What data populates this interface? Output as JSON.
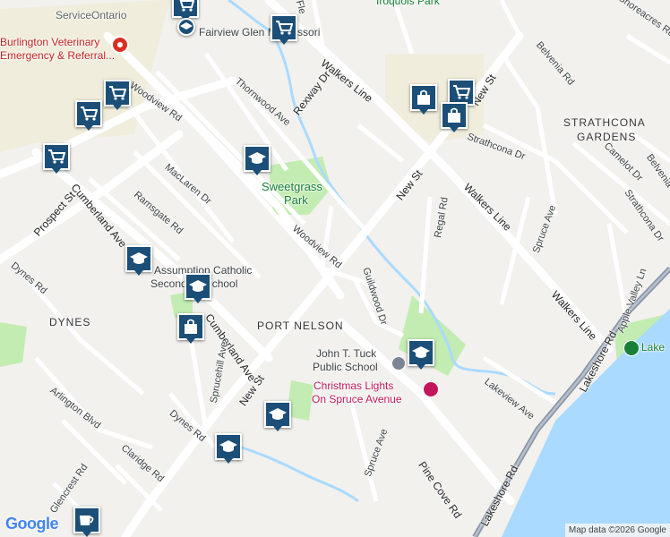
{
  "colors": {
    "water": "#aadaff",
    "park": "#c3ecb2",
    "road": "#ffffff",
    "arterial": "#ffffff",
    "highway": "#8a96a8",
    "commercial": "#f1eddc",
    "pin": "#1b4f77",
    "poi_red": "#d93025",
    "poi_pink": "#c2185b"
  },
  "areas": {
    "port_nelson": "PORT NELSON",
    "dynes": "DYNES",
    "strathcona_1": "STRATHCONA",
    "strathcona_2": "GARDENS"
  },
  "roads": {
    "walkers_line_1": "Walkers Line",
    "walkers_line_2": "Walkers Line",
    "walkers_line_3": "Walkers Line",
    "rexway": "Rexway Dr",
    "new_st_1": "New St",
    "new_st_2": "New St",
    "new_st_3": "New St",
    "cumberland_1": "Cumberland Ave",
    "cumberland_2": "Cumberland Ave",
    "prospect": "Prospect St",
    "woodview_1": "Woodview Rd",
    "woodview_2": "Woodview Rd",
    "thornwood": "Thornwood Ave",
    "maclaren": "MacLaren Dr",
    "ramsgate": "Ramsgate Rd",
    "dynes_rd_1": "Dynes Rd",
    "dynes_rd_2": "Dynes Rd",
    "spruce_hill": "Sprucehill Ave",
    "arlington": "Arlington Blvd",
    "claridge": "Claridge Rd",
    "glencrest": "Glencrest Rd",
    "guildwood": "Guildwood Dr",
    "regal": "Regal Rd",
    "spruce_ave_1": "Spruce Ave",
    "spruce_ave_2": "Spruce Ave",
    "lakeview": "Lakeview Ave",
    "pine_cove": "Pine Cove Rd",
    "lakeshore_1": "Lakeshore Rd",
    "lakeshore_2": "Lakeshore Rd",
    "strathcona_dr_1": "Strathcona Dr",
    "strathcona_dr_2": "Strathcona Dr",
    "camelot": "Camelot Dr",
    "belvenia_1": "Belvenia Rd",
    "belvenia_2": "Belvenia",
    "apple_valley": "Apple Valley Ln",
    "shoreacres": "Shoreacres Rd",
    "fle": "Fle"
  },
  "pois": {
    "service_ontario": "ServiceOntario",
    "vet_1": "Burlington Veterinary",
    "vet_2": "Emergency & Referral...",
    "fairview": "Fairview Glen Montessori",
    "iroquois": "Iroquois Park",
    "sweetgrass_1": "Sweetgrass",
    "sweetgrass_2": "Park",
    "assumption_1": "Assumption Catholic",
    "assumption_2": "Secondary School",
    "john_tuck_1": "John T. Tuck",
    "john_tuck_2": "Public School",
    "christmas_1": "Christmas Lights",
    "christmas_2": "On Spruce Avenue",
    "lake": "Lake"
  },
  "footer": {
    "logo": "Google",
    "attribution": "Map data ©2026 Google"
  }
}
